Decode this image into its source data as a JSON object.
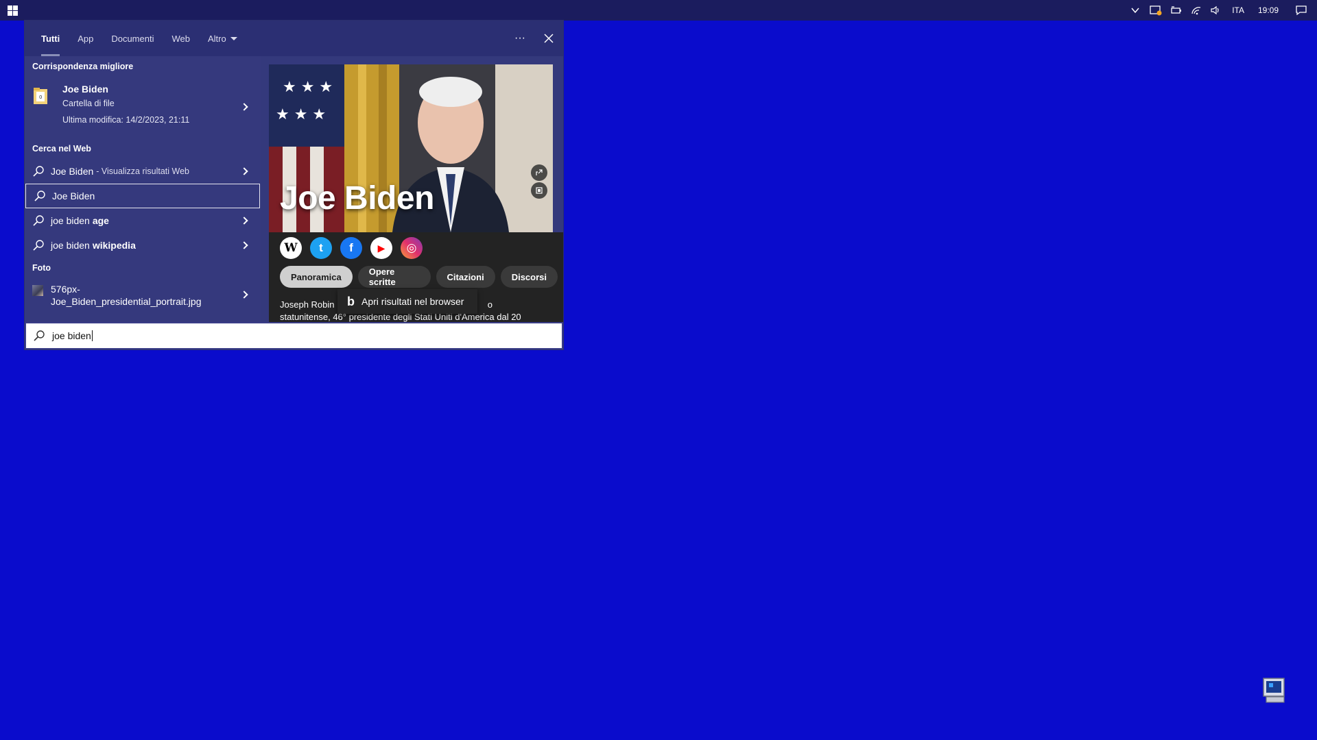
{
  "taskbar": {
    "language": "ITA",
    "time": "19:09"
  },
  "search": {
    "tabs": [
      {
        "label": "Tutti"
      },
      {
        "label": "App"
      },
      {
        "label": "Documenti"
      },
      {
        "label": "Web"
      },
      {
        "label": "Altro"
      }
    ],
    "more_label": "···",
    "best_match": {
      "section_title": "Corrispondenza migliore",
      "title": "Joe Biden",
      "subtitle": "Cartella di file",
      "modified": "Ultima modifica: 14/2/2023, 21:11"
    },
    "web": {
      "section_title": "Cerca nel Web",
      "items": [
        {
          "text": "Joe Biden",
          "hint": "- Visualizza risultati Web"
        },
        {
          "text": "Joe Biden"
        },
        {
          "text": "joe biden",
          "bold": "age"
        },
        {
          "text": "joe biden",
          "bold": "wikipedia"
        }
      ]
    },
    "photos": {
      "section_title": "Foto",
      "line1": "576px-",
      "line2": "Joe_Biden_presidential_portrait.jpg"
    },
    "preview": {
      "name": "Joe Biden",
      "chips": [
        "Panoramica",
        "Opere scritte",
        "Citazioni",
        "Discorsi"
      ],
      "snippet_line1_start": "Joseph Robin",
      "snippet_line1_end": "o",
      "snippet_line2": "statunitense, 46° presidente degli Stati Uniti d'America dal 20",
      "tooltip": "Apri risultati nel browser",
      "social": [
        "W",
        "t",
        "f",
        "▶",
        "◎"
      ]
    },
    "query": "joe biden"
  },
  "colors": {
    "desktop": "#0a0ccc",
    "taskbar": "#1b1c5e",
    "panel": "#34397c"
  }
}
